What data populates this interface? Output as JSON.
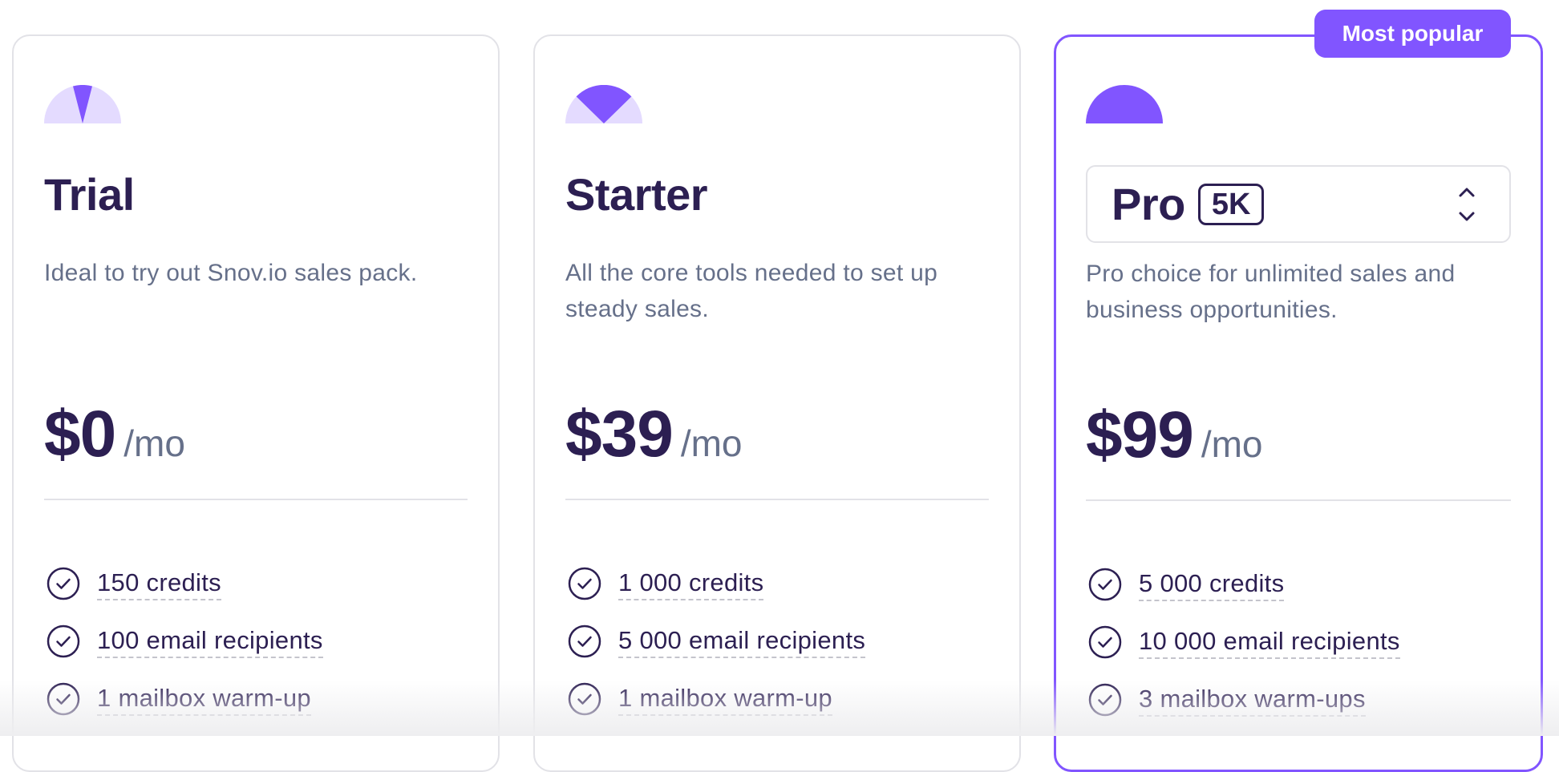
{
  "colors": {
    "accent": "#8155ff",
    "accent_light": "#e4dbff",
    "text_primary": "#2c1f52",
    "text_secondary": "#66708a",
    "border": "#e2e2e7"
  },
  "badge": {
    "label": "Most popular"
  },
  "plans": [
    {
      "id": "trial",
      "title": "Trial",
      "description": "Ideal to try out Snov.io sales pack.",
      "price": "$0",
      "period": "/mo",
      "gauge_level": "low",
      "features": [
        "150 credits",
        "100 email recipients",
        "1 mailbox warm-up"
      ]
    },
    {
      "id": "starter",
      "title": "Starter",
      "description": "All the core tools needed to set up steady sales.",
      "price": "$39",
      "period": "/mo",
      "gauge_level": "medium",
      "features": [
        "1 000 credits",
        "5 000 email recipients",
        "1 mailbox warm-up"
      ]
    },
    {
      "id": "pro",
      "title": "Pro",
      "tier": "5K",
      "description": "Pro choice for unlimited sales and business opportunities.",
      "price": "$99",
      "period": "/mo",
      "gauge_level": "full",
      "popular": true,
      "features": [
        "5 000 credits",
        "10 000 email recipients",
        "3 mailbox warm-ups"
      ]
    }
  ],
  "icons": {
    "gauge": "speedometer-icon",
    "feature": "check-circle-icon",
    "select": "chevron-up-down-icon"
  }
}
